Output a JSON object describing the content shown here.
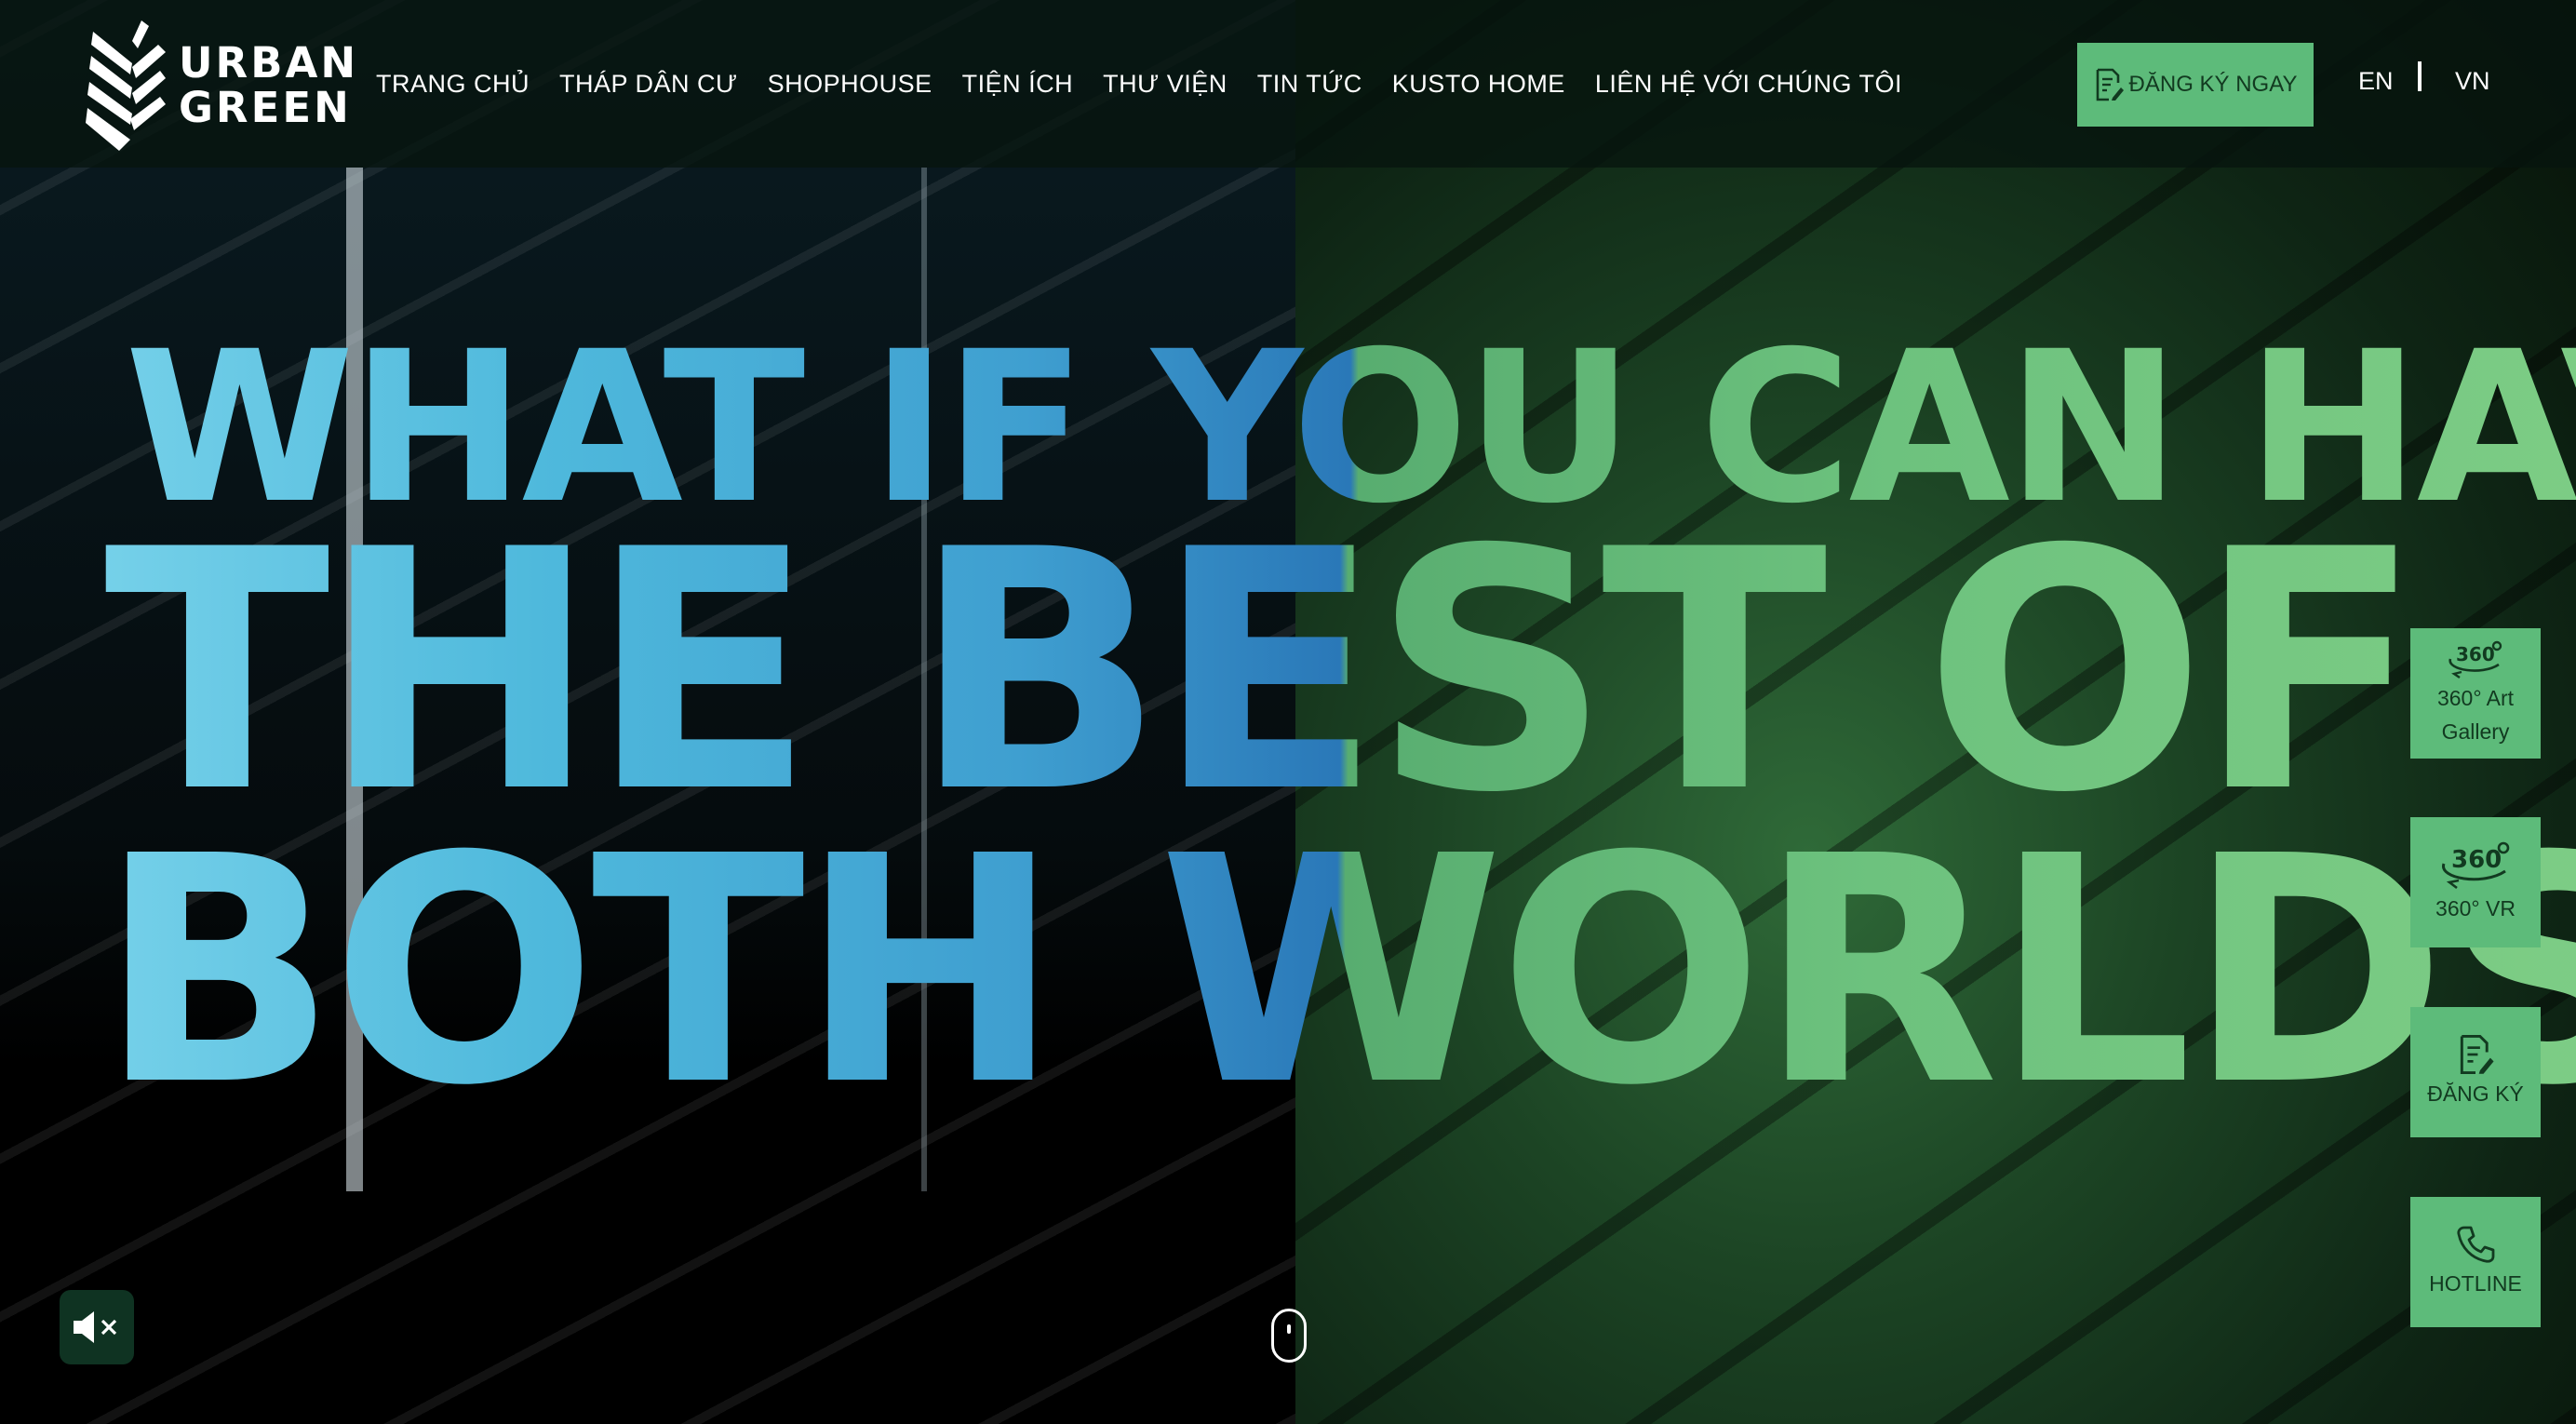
{
  "brand": {
    "line1": "URBAN",
    "line2": "GREEN"
  },
  "nav": {
    "items": [
      {
        "label": "TRANG CHỦ"
      },
      {
        "label": "THÁP DÂN CƯ"
      },
      {
        "label": "SHOPHOUSE"
      },
      {
        "label": "TIỆN ÍCH"
      },
      {
        "label": "THƯ VIỆN"
      },
      {
        "label": "TIN TỨC"
      },
      {
        "label": "KUSTO HOME"
      },
      {
        "label": "LIÊN HỆ VỚI CHÚNG TÔI"
      }
    ],
    "cta_label": "ĐĂNG KÝ NGAY"
  },
  "language": {
    "options": [
      "EN",
      "VN"
    ]
  },
  "hero": {
    "line1": "WHAT IF YOU CAN HAVE",
    "line2": "THE BEST OF",
    "line3": "BOTH WORLDS?"
  },
  "side_buttons": [
    {
      "icon": "360-icon",
      "label_line1": "360° Art",
      "label_line2": "Gallery"
    },
    {
      "icon": "360-icon",
      "label_line1": "360° VR",
      "label_line2": ""
    },
    {
      "icon": "register-icon",
      "label_line1": "ĐĂNG KÝ",
      "label_line2": ""
    },
    {
      "icon": "phone-icon",
      "label_line1": "HOTLINE",
      "label_line2": ""
    }
  ],
  "controls": {
    "mute_icon": "mute-icon",
    "scroll_icon": "scroll-mouse-icon"
  },
  "colors": {
    "accent_green": "#5dbb7a",
    "header_bg": "#06140e",
    "button_text": "#123a20"
  }
}
